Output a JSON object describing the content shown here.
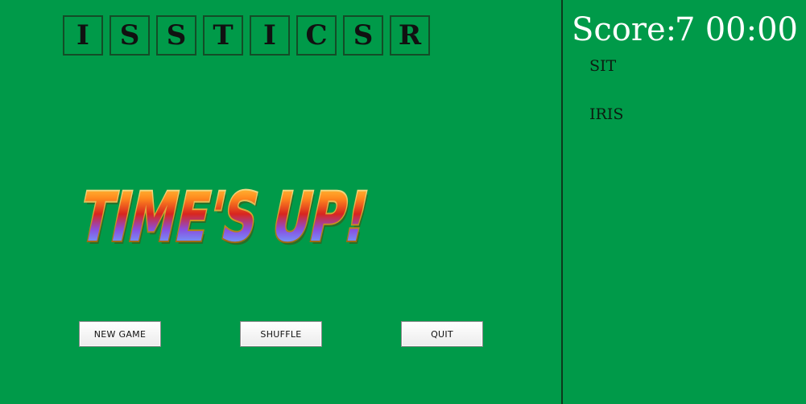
{
  "game": {
    "letters": [
      "I",
      "S",
      "S",
      "T",
      "I",
      "C",
      "S",
      "R"
    ],
    "banner_text": "TIME'S UP!",
    "buttons": {
      "new_game": "NEW GAME",
      "shuffle": "SHUFFLE",
      "quit": "QUIT"
    }
  },
  "scoreboard": {
    "score_label": "Score:",
    "score_value": "7",
    "timer": "00:00"
  },
  "found_words": [
    "SIT",
    "IRIS"
  ],
  "colors": {
    "background": "#009a49",
    "divider": "#0c3a1c",
    "score_text": "#ffffff"
  }
}
